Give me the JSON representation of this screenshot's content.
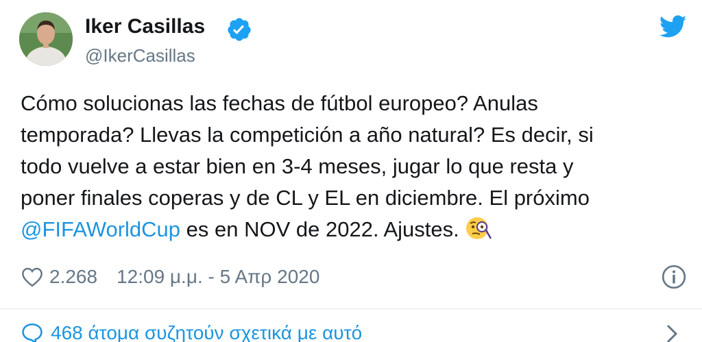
{
  "author": {
    "name": "Iker Casillas",
    "handle": "@IkerCasillas",
    "verified": true,
    "avatar_icon": "avatar-photo"
  },
  "icons": {
    "verified": "verified-badge-icon",
    "platform": "twitter-bird-icon",
    "like": "heart-icon",
    "info": "info-icon",
    "discussion": "speech-bubble-icon",
    "chevron": "chevron-right-icon",
    "emoji": "face-with-monocle-emoji"
  },
  "tweet": {
    "lines": [
      "Cómo solucionas las fechas de fútbol europeo? Anulas",
      "temporada? Llevas la competición a año natural? Es decir, si",
      "todo vuelve a estar bien en 3-4 meses, jugar lo que resta y",
      "poner finales coperas y de CL y EL en diciembre. El próximo"
    ],
    "mention": "@FIFAWorldCup",
    "last_line_rest": " es en NOV de 2022. Ajustes."
  },
  "meta": {
    "likes": "2.268",
    "timestamp": "12:09 μ.μ. - 5 Απρ 2020"
  },
  "discussion": {
    "label": "468 άτομα συζητούν σχετικά με αυτό"
  },
  "colors": {
    "text": "#14171a",
    "secondary": "#657786",
    "accent": "#1b95e0",
    "divider": "#e1e8ed"
  }
}
